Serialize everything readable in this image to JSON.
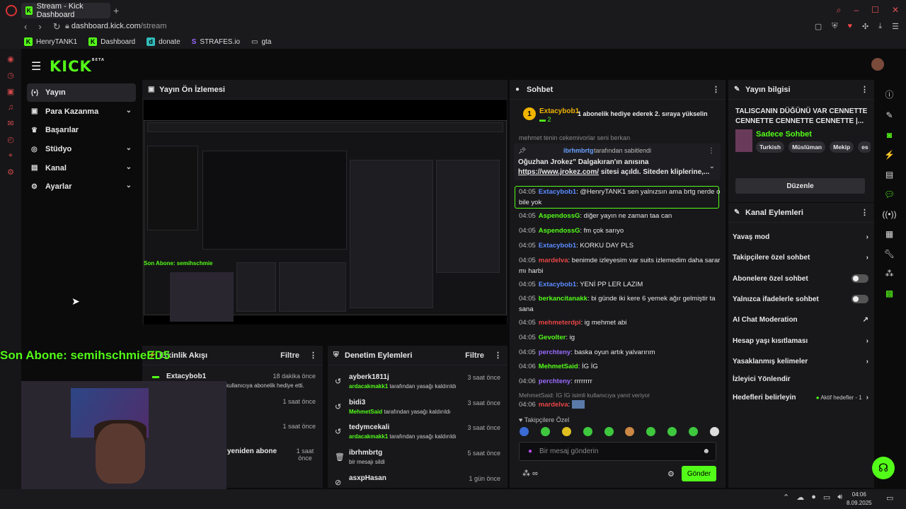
{
  "browser": {
    "tab_title": "Stream - Kick Dashboard",
    "url_domain": "dashboard.kick.com",
    "url_path": "/stream",
    "bookmarks": [
      "HenryTANK1",
      "Dashboard",
      "donate",
      "STRAFES.io",
      "gta"
    ]
  },
  "brand": {
    "logo": "KICK",
    "beta": "BETA",
    "accent": "#53fc18"
  },
  "sidebar": {
    "items": [
      {
        "label": "Yayın",
        "icon": "stream-icon"
      },
      {
        "label": "Para Kazanma",
        "icon": "money-icon"
      },
      {
        "label": "Başarılar",
        "icon": "trophy-icon"
      },
      {
        "label": "Stüdyo",
        "icon": "studio-icon"
      },
      {
        "label": "Kanal",
        "icon": "channel-icon"
      },
      {
        "label": "Ayarlar",
        "icon": "gear-icon"
      }
    ]
  },
  "preview": {
    "title": "Yayın Ön İzlemesi"
  },
  "overlay": {
    "last_sub": "Son Abone: semihschmie",
    "last_sub_suffix": "ED5"
  },
  "activity": {
    "title": "Etkinlik Akışı",
    "filter": "Filtre",
    "rows": [
      {
        "user": "Extacybob1",
        "time": "18 dakika önce",
        "desc": "kullanıcıya abonelik hediye etti."
      },
      {
        "time": "1 saat önce"
      },
      {
        "time": "1 saat önce"
      },
      {
        "desc": "yeniden abone",
        "time": "1 saat önce"
      }
    ]
  },
  "moderation": {
    "title": "Denetim Eylemleri",
    "filter": "Filtre",
    "rows": [
      {
        "user": "ayberk1811j",
        "by": "ardacakmakk1",
        "action": "tarafından yasağı kaldırıldı",
        "time": "3 saat önce",
        "icon": "undo-icon"
      },
      {
        "user": "bidi3",
        "by": "MehmetSaid",
        "action": "tarafından yasağı kaldırıldı",
        "time": "3 saat önce",
        "icon": "undo-icon"
      },
      {
        "user": "tedymcekali",
        "by": "ardacakmakk1",
        "action": "tarafından yasağı kaldırıldı",
        "time": "3 saat önce",
        "icon": "undo-icon"
      },
      {
        "user": "ibrhmbrtg",
        "action": "bir mesajı sildi",
        "time": "5 saat önce",
        "icon": "trash-icon"
      },
      {
        "user": "asxpHasan",
        "time": "1 gün önce",
        "icon": "ban-icon"
      }
    ]
  },
  "chat": {
    "title": "Sohbet",
    "top": {
      "user": "Extacybob1",
      "rank": "1",
      "count": "2",
      "msg": "1 abonelik hediye ederek 2. sıraya yükselin"
    },
    "truncated": "mehmet tenin çekemiyorlar seni berkan",
    "pinned": {
      "by": "ibrhmbrtg",
      "by_label": "tarafından sabitlendi",
      "line1": "Oğuzhan Jrokez\" Dalgakıran'ın anısına",
      "link": "https://www.jrokez.com/",
      "line2": " sitesi açıldı. Siteden kliplerine,..."
    },
    "messages": [
      {
        "time": "04:05",
        "user": "Extacybob1",
        "color": "#5b8bff",
        "text": ": @HenryTANK1 sen yalnızsın ama brtg nerde o bile yok"
      },
      {
        "time": "04:05",
        "user": "AspendossG",
        "color": "#53fc18",
        "text": ": diğer yayın ne zaman taa can"
      },
      {
        "time": "04:05",
        "user": "AspendossG",
        "color": "#53fc18",
        "text": ": fm çok sarıyo"
      },
      {
        "time": "04:05",
        "user": "Extacybob1",
        "color": "#5b8bff",
        "text": ": KORKU DAY PLS"
      },
      {
        "time": "04:05",
        "user": "mardelva",
        "color": "#e84545",
        "text": ": benimde izleyesim var suits izlemedim daha sarar mı harbi"
      },
      {
        "time": "04:05",
        "user": "Extacybob1",
        "color": "#5b8bff",
        "text": ": YENİ PP LER LAZIM"
      },
      {
        "time": "04:05",
        "user": "berkancitanakk",
        "color": "#53fc18",
        "text": ": bi günde iki kere 6 yemek ağır gelmiştir ta sana"
      },
      {
        "time": "04:05",
        "user": "mehmeterdpi",
        "color": "#e84545",
        "text": ": ig mehmet abi"
      },
      {
        "time": "04:05",
        "user": "Gevolter",
        "color": "#53fc18",
        "text": ": ig"
      },
      {
        "time": "04:05",
        "user": "perchteny",
        "color": "#9a6bff",
        "text": ": baska oyun artık yalvarırım"
      },
      {
        "time": "04:06",
        "user": "MehmetSaid",
        "color": "#53fc18",
        "text": ": İG İG"
      },
      {
        "time": "04:06",
        "user": "perchteny",
        "color": "#9a6bff",
        "text": ": rrrrrrrr"
      }
    ],
    "reply_note": "MehmetSaid: İG İG isimli kullanıcıya yanıt veriyor",
    "last": {
      "time": "04:06",
      "user": "mardelva",
      "color": "#e84545"
    },
    "followers_only": "Takipçilere Özel",
    "input_placeholder": "Bir mesaj gönderin",
    "send_label": "Gönder"
  },
  "info": {
    "title": "Yayın bilgisi",
    "stream_title": "TALISCANIN DÜĞÜNÜ VAR CENNETTE CENNETTE CENNETTE CENNETTE |...",
    "category": "Sadece Sohbet",
    "tags": [
      "Turkish",
      "Müslüman",
      "Mekip",
      "es"
    ],
    "edit_label": "Düzenle"
  },
  "actions": {
    "title": "Kanal Eylemleri",
    "rows": [
      {
        "label": "Yavaş mod",
        "kind": "chevron"
      },
      {
        "label": "Takipçilere özel sohbet",
        "kind": "chevron"
      },
      {
        "label": "Abonelere özel sohbet",
        "kind": "toggle"
      },
      {
        "label": "Yalnızca ifadelerle sohbet",
        "kind": "toggle"
      },
      {
        "label": "AI Chat Moderation",
        "kind": "external"
      },
      {
        "label": "Hesap yaşı kısıtlaması",
        "kind": "chevron"
      },
      {
        "label": "Yasaklanmış kelimeler",
        "kind": "chevron"
      },
      {
        "label": "İzleyici Yönlendir",
        "kind": "none"
      },
      {
        "label": "Hedefleri belirleyin",
        "kind": "goal",
        "note": "Aktif hedefler - 1"
      }
    ]
  },
  "taskbar": {
    "time": "04:06",
    "date": "8.09.2025"
  }
}
